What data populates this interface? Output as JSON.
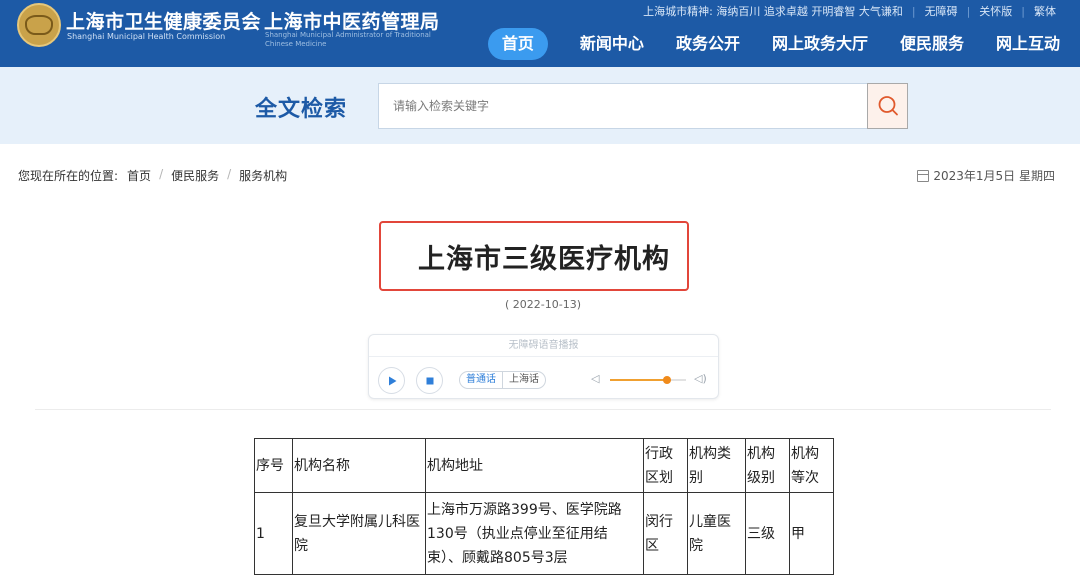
{
  "header": {
    "org1_cn": "上海市卫生健康委员会",
    "org1_en": "Shanghai Municipal Health Commission",
    "org2_cn": "上海市中医药管理局",
    "org2_en": "Shanghai Municipal Administrator of Traditional Chinese Medicine",
    "spirit": "上海城市精神: 海纳百川 追求卓越 开明睿智 大气谦和",
    "accessibility": "无障碍",
    "care_mode": "关怀版",
    "traditional": "繁体",
    "nav": [
      "首页",
      "新闻中心",
      "政务公开",
      "网上政务大厅",
      "便民服务",
      "网上互动"
    ],
    "brand_color": "#1d5aa6"
  },
  "search": {
    "title": "全文检索",
    "placeholder": "请输入检索关键字",
    "button_icon": "search-icon"
  },
  "breadcrumb": {
    "prefix": "您现在所在的位置:",
    "items": [
      "首页",
      "便民服务",
      "服务机构"
    ]
  },
  "date": "2023年1月5日 星期四",
  "article": {
    "title": "上海市三级医疗机构",
    "published": "( 2022-10-13)"
  },
  "player": {
    "header": "无障碍语音播报",
    "lang_active": "普通话",
    "lang_other": "上海话",
    "volume": 0.75
  },
  "table": {
    "headers": [
      "序号",
      "机构名称",
      "机构地址",
      "行政区划",
      "机构类别",
      "机构级别",
      "机构等次"
    ],
    "rows": [
      [
        "1",
        "复旦大学附属儿科医院",
        "上海市万源路399号、医学院路130号（执业点停业至征用结束）、顾戴路805号3层",
        "闵行区",
        "儿童医院",
        "三级",
        "甲"
      ]
    ]
  }
}
